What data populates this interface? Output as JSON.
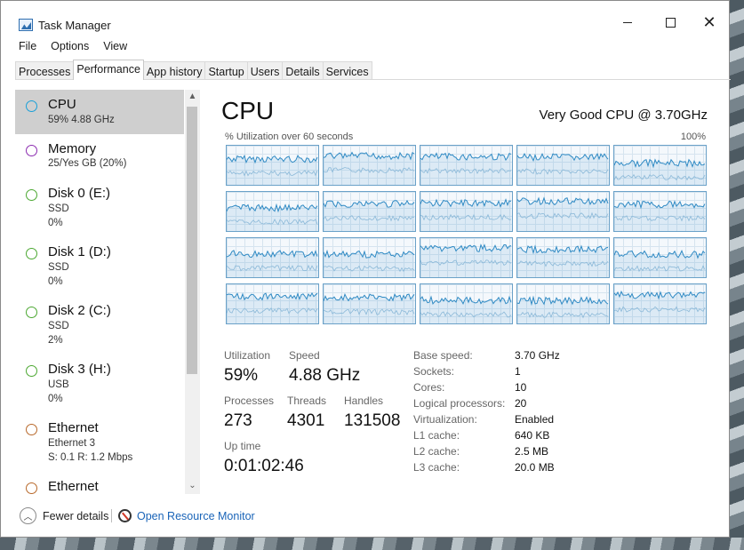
{
  "window": {
    "title": "Task Manager"
  },
  "menu": [
    "File",
    "Options",
    "View"
  ],
  "tabs": [
    "Processes",
    "Performance",
    "App history",
    "Startup",
    "Users",
    "Details",
    "Services"
  ],
  "active_tab": "Performance",
  "sidebar": {
    "items": [
      {
        "title": "CPU",
        "sub1": "59%  4.88 GHz",
        "sub2": "",
        "color": "#1aa0d8",
        "selected": true
      },
      {
        "title": "Memory",
        "sub1": "25/Yes GB (20%)",
        "sub2": "",
        "color": "#8c2cb0"
      },
      {
        "title": "Disk 0 (E:)",
        "sub1": "SSD",
        "sub2": "0%",
        "color": "#4ca832"
      },
      {
        "title": "Disk 1 (D:)",
        "sub1": "SSD",
        "sub2": "0%",
        "color": "#4ca832"
      },
      {
        "title": "Disk 2 (C:)",
        "sub1": "SSD",
        "sub2": "2%",
        "color": "#4ca832"
      },
      {
        "title": "Disk 3 (H:)",
        "sub1": "USB",
        "sub2": "0%",
        "color": "#4ca832"
      },
      {
        "title": "Ethernet",
        "sub1": "Ethernet 3",
        "sub2": "S: 0.1  R: 1.2 Mbps",
        "color": "#b8692b"
      },
      {
        "title": "Ethernet",
        "sub1": "",
        "sub2": "",
        "color": "#b8692b"
      }
    ]
  },
  "main": {
    "title": "CPU",
    "cpu_name": "Very Good CPU @ 3.70GHz",
    "graph_label": "% Utilization over 60 seconds",
    "graph_max": "100%",
    "logical_processor_graphs": 20,
    "graph_color": "#2f8ac4"
  },
  "stats": {
    "utilization_label": "Utilization",
    "utilization": "59%",
    "speed_label": "Speed",
    "speed": "4.88 GHz",
    "processes_label": "Processes",
    "processes": "273",
    "threads_label": "Threads",
    "threads": "4301",
    "handles_label": "Handles",
    "handles": "131508",
    "uptime_label": "Up time",
    "uptime": "0:01:02:46"
  },
  "specs": [
    {
      "label": "Base speed:",
      "value": "3.70 GHz"
    },
    {
      "label": "Sockets:",
      "value": "1"
    },
    {
      "label": "Cores:",
      "value": "10"
    },
    {
      "label": "Logical processors:",
      "value": "20"
    },
    {
      "label": "Virtualization:",
      "value": "Enabled"
    },
    {
      "label": "L1 cache:",
      "value": "640 KB"
    },
    {
      "label": "L2 cache:",
      "value": "2.5 MB"
    },
    {
      "label": "L3 cache:",
      "value": "20.0 MB"
    }
  ],
  "footer": {
    "fewer_details": "Fewer details",
    "resource_monitor": "Open Resource Monitor"
  },
  "icons": {
    "app": "task-manager-icon",
    "fewer": "chevron-up-icon",
    "resource_monitor": "resource-monitor-icon"
  }
}
